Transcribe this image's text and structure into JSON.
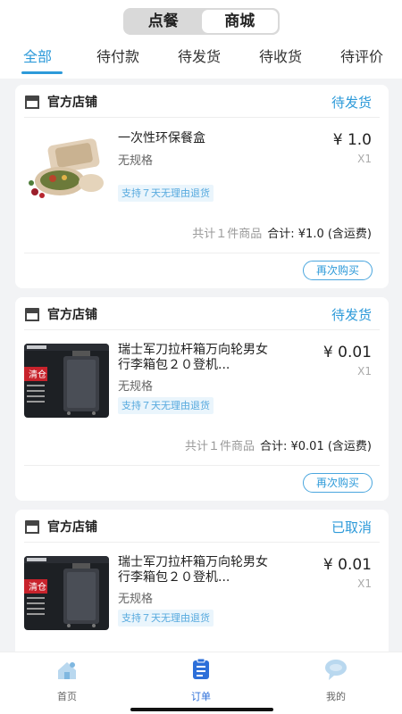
{
  "segment": {
    "order_food": "点餐",
    "mall": "商城"
  },
  "tabs": [
    {
      "label": "全部"
    },
    {
      "label": "待付款"
    },
    {
      "label": "待发货"
    },
    {
      "label": "待收货"
    },
    {
      "label": "待评价"
    }
  ],
  "orders": [
    {
      "shop": "官方店铺",
      "status": "待发货",
      "title": "一次性环保餐盒",
      "spec": "无规格",
      "badge": "支持７天无理由退货",
      "price": "¥ 1.0",
      "qty": "X1",
      "count": "共计１件商品",
      "total": "合计: ¥1.0 (含运费)",
      "rebuy": "再次购买"
    },
    {
      "shop": "官方店铺",
      "status": "待发货",
      "title": "瑞士军刀拉杆箱万向轮男女行李箱包２０登机...",
      "spec": "无规格",
      "badge": "支持７天无理由退货",
      "price": "¥ 0.01",
      "qty": "X1",
      "count": "共计１件商品",
      "total": "合计: ¥0.01 (含运费)",
      "rebuy": "再次购买",
      "thumb_text": "清仓"
    },
    {
      "shop": "官方店铺",
      "status": "已取消",
      "title": "瑞士军刀拉杆箱万向轮男女行李箱包２０登机...",
      "spec": "无规格",
      "badge": "支持７天无理由退货",
      "price": "¥ 0.01",
      "qty": "X1",
      "thumb_text": "清仓"
    }
  ],
  "nav": [
    {
      "label": "首页",
      "icon": "home-icon"
    },
    {
      "label": "订单",
      "icon": "order-icon"
    },
    {
      "label": "我的",
      "icon": "profile-icon"
    }
  ],
  "colors": {
    "accent": "#2d9ad9",
    "nav_active": "#2d6fd9"
  }
}
